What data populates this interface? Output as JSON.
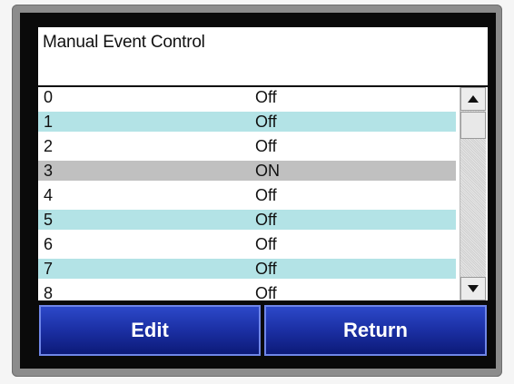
{
  "title": "Manual Event Control",
  "events": [
    {
      "num": "0",
      "state": "Off"
    },
    {
      "num": "1",
      "state": "Off"
    },
    {
      "num": "2",
      "state": "Off"
    },
    {
      "num": "3",
      "state": "ON"
    },
    {
      "num": "4",
      "state": "Off"
    },
    {
      "num": "5",
      "state": "Off"
    },
    {
      "num": "6",
      "state": "Off"
    },
    {
      "num": "7",
      "state": "Off"
    },
    {
      "num": "8",
      "state": "Off"
    }
  ],
  "selected_event_index": 3,
  "buttons": {
    "edit": "Edit",
    "return": "Return"
  },
  "scrollbar": {
    "up_icon": "up-arrow-icon",
    "down_icon": "down-arrow-icon"
  },
  "colors": {
    "row_alt": "#b3e3e6",
    "row_selected": "#c0c0c0",
    "button": "#1b2fa3"
  }
}
